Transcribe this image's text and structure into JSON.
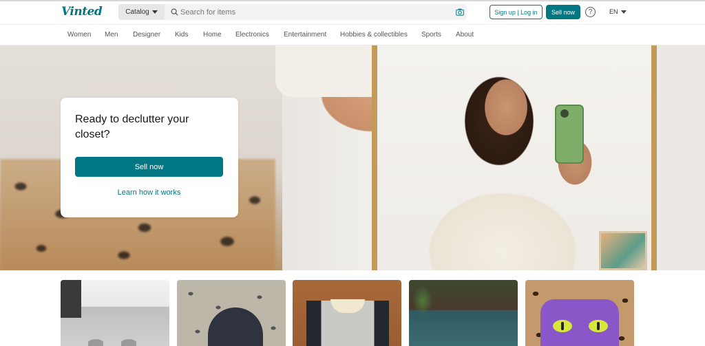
{
  "header": {
    "logo_text": "Vinted",
    "catalog_label": "Catalog",
    "search_placeholder": "Search for items",
    "login_label": "Sign up | Log in",
    "sell_label": "Sell now",
    "help_symbol": "?",
    "language": "EN"
  },
  "nav": {
    "items": [
      "Women",
      "Men",
      "Designer",
      "Kids",
      "Home",
      "Electronics",
      "Entertainment",
      "Hobbies & collectibles",
      "Sports",
      "About"
    ]
  },
  "hero": {
    "title": "Ready to declutter your closet?",
    "sell_button": "Sell now",
    "learn_link": "Learn how it works"
  },
  "colors": {
    "brand": "#007782",
    "text": "#171717",
    "nav_text": "#555555"
  },
  "icons": {
    "search": "search-icon",
    "camera": "camera-icon",
    "help": "help-icon",
    "caret": "chevron-down-icon"
  }
}
